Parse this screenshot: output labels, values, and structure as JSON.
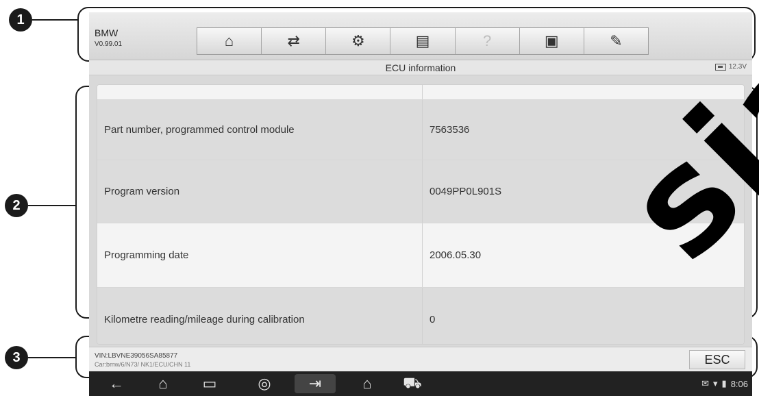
{
  "app": {
    "name": "BMW",
    "version": "V0.99.01"
  },
  "toolbar": {
    "buttons": [
      {
        "icon": "home-icon",
        "glyph": "⌂"
      },
      {
        "icon": "vehicle-swap-icon",
        "glyph": "⇄"
      },
      {
        "icon": "settings-gear-icon",
        "glyph": "⚙"
      },
      {
        "icon": "print-icon",
        "glyph": "▤"
      },
      {
        "icon": "help-icon",
        "glyph": "?"
      },
      {
        "icon": "save-icon",
        "glyph": "▣"
      },
      {
        "icon": "edit-pencil-icon",
        "glyph": "✎"
      }
    ]
  },
  "title_bar": {
    "title": "ECU information",
    "battery_voltage": "12.3V"
  },
  "table": {
    "rows": [
      {
        "label": "Part number, programmed control module",
        "value": "7563536"
      },
      {
        "label": "Program version",
        "value": "0049PP0L901S"
      },
      {
        "label": "Programming date",
        "value": "2006.05.30"
      },
      {
        "label": "Kilometre reading/mileage during calibration",
        "value": "0"
      }
    ]
  },
  "status_bar": {
    "vin": "VIN:LBVNE39056SA85877",
    "path": "Car:bmw/6/N73/ NK1/ECU/CHN 11",
    "esc_label": "ESC"
  },
  "system_bar": {
    "time": "8:06"
  },
  "callouts": [
    "1",
    "2",
    "3"
  ],
  "watermark": "sia",
  "colors": {
    "callout": "#1b1b1b",
    "screen_bg": "#d9d9d9",
    "nav_bar": "#222222"
  }
}
